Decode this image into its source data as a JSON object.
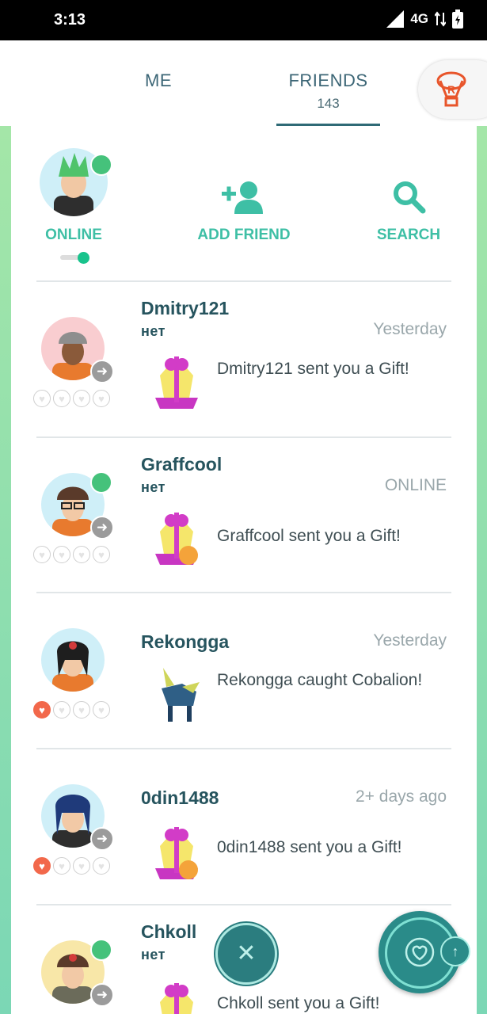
{
  "status_bar": {
    "time": "3:13",
    "network": "4G"
  },
  "tabs": {
    "me": {
      "label": "ME"
    },
    "friends": {
      "label": "FRIENDS",
      "count": "143"
    }
  },
  "profile": {
    "status_label": "ONLINE"
  },
  "actions": {
    "add_friend": "ADD FRIEND",
    "search": "SEARCH"
  },
  "friends": [
    {
      "name": "Dmitry121",
      "team": "нет",
      "time": "Yesterday",
      "message": "Dmitry121 sent you a Gift!",
      "online": false,
      "hearts_filled": 0,
      "activity": "gift"
    },
    {
      "name": "Graffcool",
      "team": "нет",
      "time": "ONLINE",
      "message": "Graffcool sent you a Gift!",
      "online": true,
      "hearts_filled": 0,
      "activity": "gift-pikachu"
    },
    {
      "name": "Rekongga",
      "team": "",
      "time": "Yesterday",
      "message": "Rekongga caught Cobalion!",
      "online": false,
      "hearts_filled": 1,
      "activity": "pokemon"
    },
    {
      "name": "0din1488",
      "team": "",
      "time": "2+ days ago",
      "message": "0din1488 sent you a Gift!",
      "online": false,
      "hearts_filled": 1,
      "activity": "gift-pikachu"
    },
    {
      "name": "Chkoll",
      "team": "нет",
      "time": "",
      "message": "Chkoll sent you a Gift!",
      "online": true,
      "hearts_filled": 1,
      "activity": "gift"
    }
  ],
  "colors": {
    "accent": "#3ebfa5",
    "name_text": "#26545e",
    "online": "#45c27b",
    "heart": "#f2684b"
  }
}
